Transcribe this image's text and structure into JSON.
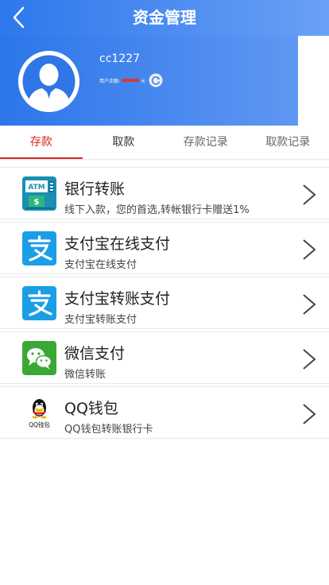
{
  "header": {
    "title": "资金管理"
  },
  "profile": {
    "username": "cc1227",
    "balance_label": "用户余额:",
    "balance_unit": "元"
  },
  "tabs": [
    {
      "label": "存款"
    },
    {
      "label": "取款"
    },
    {
      "label": "存款记录"
    },
    {
      "label": "取款记录"
    }
  ],
  "methods": [
    {
      "title": "银行转账",
      "subtitle": "线下入款，您的首选,转帐银行卡赠送1%",
      "icon": "atm-icon"
    },
    {
      "title": "支付宝在线支付",
      "subtitle": "支付宝在线支付",
      "icon": "alipay-icon"
    },
    {
      "title": "支付宝转账支付",
      "subtitle": "支付宝转账支付",
      "icon": "alipay-icon"
    },
    {
      "title": "微信支付",
      "subtitle": "微信转账",
      "icon": "wechat-icon"
    },
    {
      "title": "QQ钱包",
      "subtitle": "QQ钱包转账银行卡",
      "icon": "qq-wallet-icon",
      "icon_text": "QQ钱包"
    }
  ],
  "colors": {
    "header": "#2d78ec",
    "accent": "#d9251d",
    "alipay": "#1a9ee6",
    "wechat": "#3aa835"
  }
}
